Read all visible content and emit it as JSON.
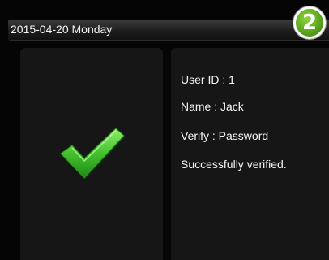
{
  "header": {
    "date_text": "2015-04-20  Monday"
  },
  "badge": {
    "number": "2"
  },
  "status": {
    "icon": "checkmark-icon",
    "lines": [
      "User ID : 1",
      "Name : Jack",
      "Verify : Password",
      "Successfully verified."
    ]
  },
  "colors": {
    "check_green": "#4fd13a",
    "badge_green": "#5aa51e",
    "panel_bg": "#161616",
    "screen_bg": "#050505"
  }
}
